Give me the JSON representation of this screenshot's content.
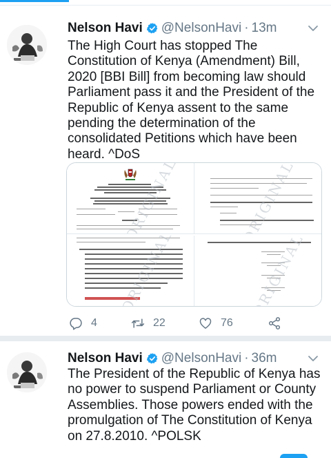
{
  "tweets": [
    {
      "author": {
        "name": "Nelson Havi",
        "handle": "@NelsonHavi",
        "verified": true
      },
      "separator": "·",
      "time": "13m",
      "text": "The High Court has stopped The Constitution of Kenya (Amendment) Bill, 2020 [BBI Bill] from becoming law should Parliament pass it and the President of the Republic of Kenya assent to the same pending the determination of the consolidated Petitions which have been heard. ^DoS",
      "media": {
        "doc_title_lines": [
          "REPUBLIC OF KENYA",
          "IN THE HIGH COURT OF KENYA AT NAIROBI",
          "CONSTITUTIONAL AND HUMAN RIGHTS DIVISION",
          "PETITION NO. E282 OF 2020"
        ],
        "doc_consolidated": "(CONSOLIDATED WITH PETITION NOs. 397 OF 2020, E400 OF 2020, E401 OF 2020, E402 OF 2020, E416 OF 2020 AND E426 OF 2020)",
        "doc_parties": [
          "DAVID NDII & OTHERS ..................PETITIONERS",
          "VERSUS",
          "ATTORNEY GENERAL & OTHERS..............RESPONDENTS"
        ],
        "doc_heading": "RULING",
        "doc_bottom_left": "Accordingly, the order which commends itself to us as the appropriate relief in the circumstances to preserve the subject matter of the Consolidated Petitions, and which we hereby grant, is that any assent contemplated under Article 256(4) of the Constitution, if it were to be given to the Constitutional Amendment Bill, 2020, shall not come into force until the determination of these consolidated Petitions.",
        "doc_bottom_right_dated": "Dated, Signed and delivered at Nairobi this 26th day of March, 2021",
        "judges": [
          {
            "name": "JOEL M. NGUGI",
            "title": "JUDGE"
          },
          {
            "name": "G. V. ODUNGA",
            "title": "JUDGE"
          },
          {
            "name": "NGAAH JAIRUS",
            "title": "JUDGE"
          },
          {
            "name": "E.C. MWITA",
            "title": "JUDGE"
          }
        ],
        "watermark": "ORIGINAL"
      },
      "actions": {
        "replies": "4",
        "retweets": "22",
        "likes": "76"
      }
    },
    {
      "author": {
        "name": "Nelson Havi",
        "handle": "@NelsonHavi",
        "verified": true
      },
      "separator": "·",
      "time": "36m",
      "text": "The President of the Republic of Kenya has no power to suspend Parliament or County Assemblies. Those powers ended with the promulgation of The Constitution of Kenya on 27.8.2010. ^POLSK"
    }
  ],
  "colors": {
    "accent": "#1da1f2",
    "text": "#14171a",
    "secondary": "#657786",
    "divider": "#e6ecf0",
    "verified": "#1da1f2"
  },
  "icons": {
    "reply": "comment-bubble-icon",
    "retweet": "retweet-arrows-icon",
    "like": "heart-outline-icon",
    "share": "share-nodes-icon",
    "more": "chevron-down-icon",
    "verified": "verified-badge-icon"
  }
}
